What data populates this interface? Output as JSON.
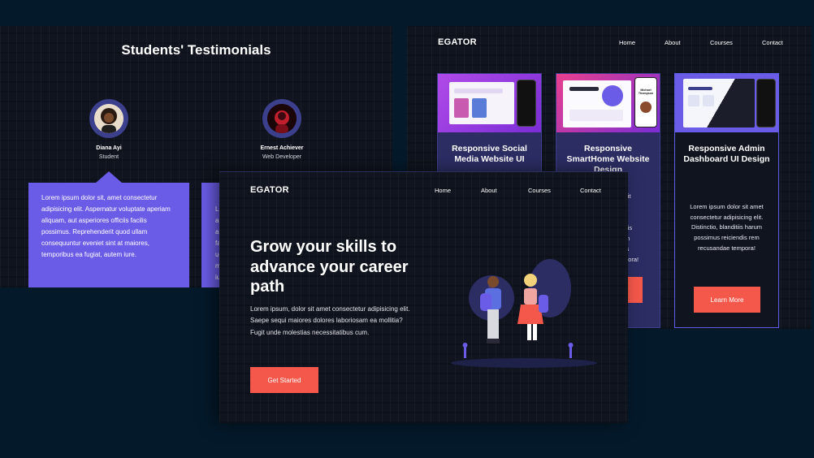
{
  "testimonials": {
    "title": "Students' Testimonials",
    "people": [
      {
        "name": "Diana Ayi",
        "role": "Student"
      },
      {
        "name": "Ernest Achiever",
        "role": "Web Developer"
      }
    ],
    "quote": "Lorem ipsum dolor sit, amet consectetur adipisicing elit. Aspernatur voluptate aperiam aliquam, aut asperiores officiis facilis possimus. Reprehenderit quod ullam consequuntur eveniet sint at maiores, temporibus ea fugiat, autem iure.",
    "quote2_partial": "L\na\na\nfa\nu\nm\niu"
  },
  "courses_page": {
    "logo": "EGATOR",
    "nav": [
      "Home",
      "About",
      "Courses",
      "Contact"
    ],
    "cards": [
      {
        "title": "Responsive Social Media Website UI",
        "desc": "",
        "button": "",
        "thumb_color": "#9b3fe3"
      },
      {
        "title": "Responsive SmartHome Website Design",
        "desc": "sit\nc\nt\nitis\nm\nis\npora!",
        "button": "",
        "thumb_color": "#8a2ee0",
        "mock_name": "Michael Thompson"
      },
      {
        "title": "Responsive Admin Dashboard UI Design",
        "desc": "Lorem ipsum dolor sit amet consectetur adipisicing elit. Distinctio, blanditiis harum possimus reiciendis rem recusandae tempora!",
        "button": "Learn More",
        "thumb_color": "#6b5ce7"
      }
    ]
  },
  "hero": {
    "logo": "EGATOR",
    "nav": [
      "Home",
      "About",
      "Courses",
      "Contact"
    ],
    "heading": "Grow your skills to advance your career path",
    "text": "Lorem ipsum, dolor sit amet consectetur adipisicing elit. Saepe sequi maiores dolores laboriosam ea mollitia? Fugit unde molestias necessitatibus cum.",
    "button": "Get Started"
  },
  "colors": {
    "background": "#04192a",
    "panel": "#0f141e",
    "accent_purple": "#6b5ce7",
    "card_body": "#2b2d63",
    "button_orange": "#f4584a"
  }
}
